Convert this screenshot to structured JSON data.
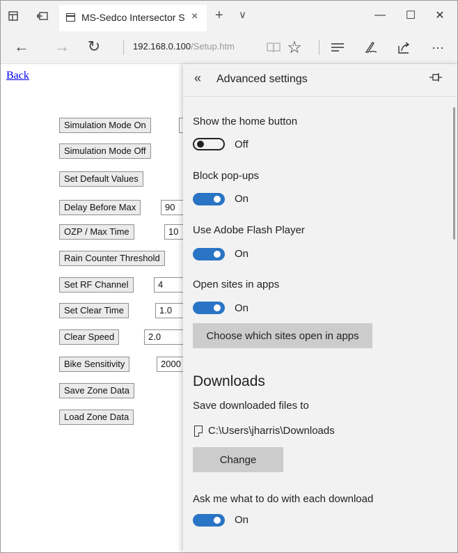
{
  "window": {
    "tab_title": "MS-Sedco Intersector S",
    "tab_close": "×",
    "new_tab": "+",
    "tab_list": "∨",
    "minimize": "—",
    "maximize": "☐",
    "close": "✕"
  },
  "nav": {
    "back": "←",
    "forward": "→",
    "refresh": "↻",
    "address_host": "192.168.0.100",
    "address_path": "/Setup.htm",
    "reading_view": "📖",
    "favorite": "☆",
    "hub": "≡",
    "notes": "✎",
    "share": "⇪",
    "more": "···"
  },
  "page": {
    "back_link": "Back",
    "buttons": {
      "sim_on": "Simulation Mode On",
      "sim_off": "Simulation Mode Off",
      "defaults": "Set Default Values",
      "delay_max": "Delay Before Max",
      "ozp_max": "OZP / Max Time",
      "rain": "Rain Counter Threshold",
      "rf_channel": "Set RF Channel",
      "clear_time": "Set Clear Time",
      "clear_speed": "Clear Speed",
      "bike_sens": "Bike Sensitivity",
      "save_zone": "Save Zone Data",
      "load_zone": "Load Zone Data"
    },
    "values": {
      "sim_on": "",
      "delay_max": "90",
      "ozp_max": "10",
      "rf_channel": "4",
      "clear_time": "1.0",
      "clear_speed": "2.0",
      "bike_sens": "2000"
    }
  },
  "settings": {
    "back_chevron": "«",
    "title": "Advanced settings",
    "pin": "⊣⊢",
    "home_button": {
      "label": "Show the home button",
      "state": "Off"
    },
    "popups": {
      "label": "Block pop-ups",
      "state": "On"
    },
    "flash": {
      "label": "Use Adobe Flash Player",
      "state": "On"
    },
    "open_apps": {
      "label": "Open sites in apps",
      "state": "On"
    },
    "choose_sites": "Choose which sites open in apps",
    "downloads_heading": "Downloads",
    "save_to_label": "Save downloaded files to",
    "download_path": "C:\\Users\\jharris\\Downloads",
    "change_button": "Change",
    "ask_download": {
      "label": "Ask me what to do with each download",
      "state": "On"
    }
  },
  "colors": {
    "toggle_on": "#2a74c5",
    "panel_bg": "#f2f2f2",
    "link": "#0000ee"
  }
}
